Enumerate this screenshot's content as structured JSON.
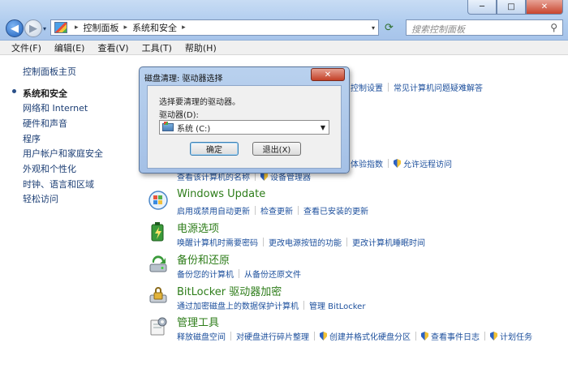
{
  "window": {
    "minimize_glyph": "─",
    "maximize_glyph": "□",
    "close_glyph": "✕"
  },
  "nav": {
    "back_glyph": "◀",
    "forward_glyph": "▶",
    "history_glyph": "▾"
  },
  "address": {
    "crumbs": [
      "控制面板",
      "系统和安全"
    ],
    "separator": "▸",
    "dropdown_glyph": "▾",
    "refresh_glyph": "⟳"
  },
  "search": {
    "placeholder": "搜索控制面板",
    "icon_glyph": "⚲"
  },
  "menubar": [
    "文件(F)",
    "编辑(E)",
    "查看(V)",
    "工具(T)",
    "帮助(H)"
  ],
  "sidebar": {
    "items": [
      "控制面板主页",
      "系统和安全",
      "网络和 Internet",
      "硬件和声音",
      "程序",
      "用户帐户和家庭安全",
      "外观和个性化",
      "时钟、语言和区域",
      "轻松访问"
    ],
    "current_index": 1
  },
  "partial_rows": {
    "row1": [
      "控制设置",
      "常见计算机问题疑难解答"
    ],
    "row2": [
      "体验指数",
      "允许远程访问"
    ],
    "row3": [
      "查看该计算机的名称",
      "设备管理器"
    ]
  },
  "categories": [
    {
      "title": "Windows Update",
      "links": [
        "启用或禁用自动更新",
        "检查更新",
        "查看已安装的更新"
      ],
      "shield": [
        false,
        false,
        false
      ]
    },
    {
      "title": "电源选项",
      "links": [
        "唤醒计算机时需要密码",
        "更改电源按钮的功能",
        "更改计算机睡眠时间"
      ],
      "shield": [
        false,
        false,
        false
      ]
    },
    {
      "title": "备份和还原",
      "links": [
        "备份您的计算机",
        "从备份还原文件"
      ],
      "shield": [
        false,
        false
      ]
    },
    {
      "title": "BitLocker 驱动器加密",
      "links": [
        "通过加密磁盘上的数据保护计算机",
        "管理 BitLocker"
      ],
      "shield": [
        false,
        false
      ]
    },
    {
      "title": "管理工具",
      "links": [
        "释放磁盘空间",
        "对硬盘进行碎片整理",
        "创建并格式化硬盘分区",
        "查看事件日志",
        "计划任务"
      ],
      "shield": [
        false,
        false,
        true,
        true,
        true
      ]
    }
  ],
  "dialog": {
    "title": "磁盘清理: 驱动器选择",
    "close_glyph": "✕",
    "prompt": "选择要清理的驱动器。",
    "drive_label": "驱动器(D):",
    "selected_drive": "系统  (C:)",
    "dropdown_glyph": "▼",
    "ok_label": "确定",
    "exit_label": "退出(X)"
  },
  "colors": {
    "category_title": "#2e7d1a",
    "link": "#1c4f9c",
    "close_red": "#c34027"
  }
}
